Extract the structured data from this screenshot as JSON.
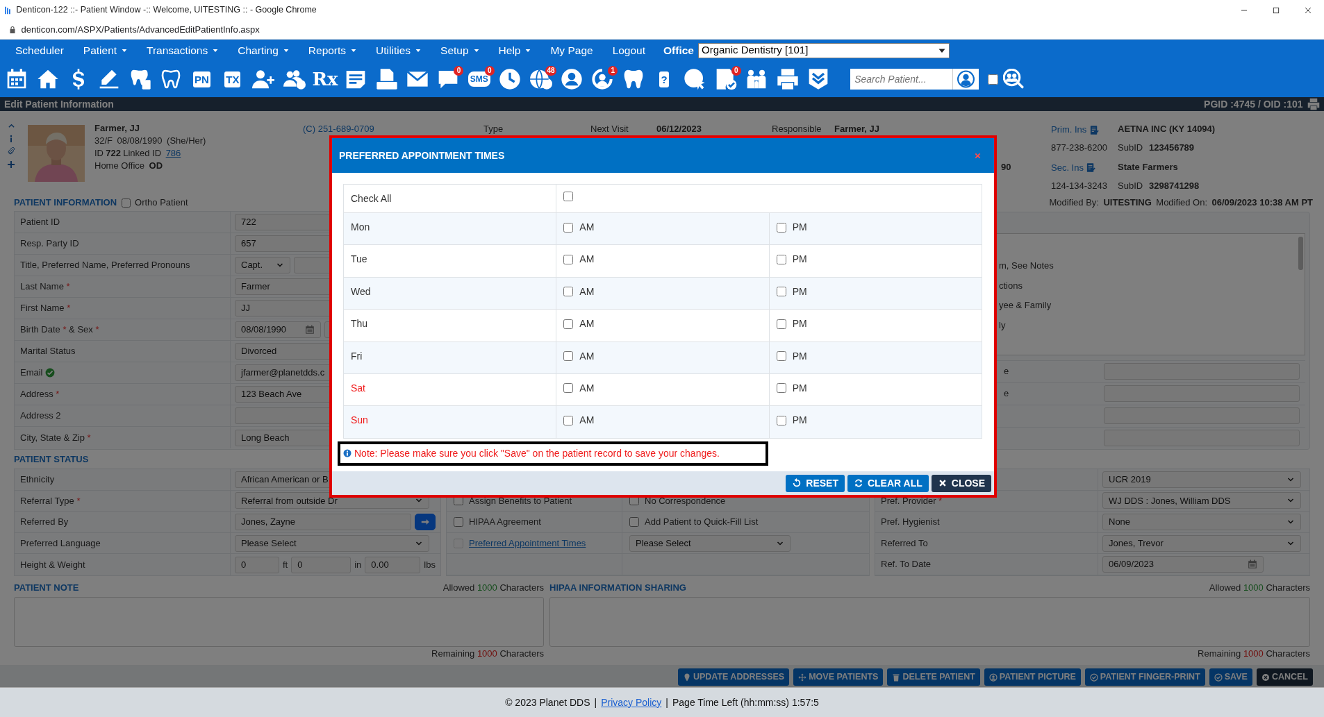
{
  "browser": {
    "title": "Denticon-122 ::- Patient Window -:: Welcome, UITESTING :: - Google Chrome",
    "url": "denticon.com/ASPX/Patients/AdvancedEditPatientInfo.aspx"
  },
  "menu": [
    {
      "label": "Scheduler",
      "dropdown": false
    },
    {
      "label": "Patient",
      "dropdown": true
    },
    {
      "label": "Transactions",
      "dropdown": true
    },
    {
      "label": "Charting",
      "dropdown": true
    },
    {
      "label": "Reports",
      "dropdown": true
    },
    {
      "label": "Utilities",
      "dropdown": true
    },
    {
      "label": "Setup",
      "dropdown": true
    },
    {
      "label": "Help",
      "dropdown": true
    },
    {
      "label": "My Page",
      "dropdown": false
    },
    {
      "label": "Logout",
      "dropdown": false
    }
  ],
  "office": {
    "label": "Office",
    "value": "Organic Dentistry [101]"
  },
  "toolbar": [
    {
      "kind": "calendar"
    },
    {
      "kind": "home"
    },
    {
      "kind": "dollar"
    },
    {
      "kind": "edit"
    },
    {
      "kind": "tooth-doc"
    },
    {
      "kind": "tooth-outline"
    },
    {
      "kind": "box-text",
      "label": "PN"
    },
    {
      "kind": "box-text",
      "label": "TX"
    },
    {
      "kind": "person-add"
    },
    {
      "kind": "people-add"
    },
    {
      "kind": "plain-text",
      "label": "Rx"
    },
    {
      "kind": "note"
    },
    {
      "kind": "scanner"
    },
    {
      "kind": "envelope"
    },
    {
      "kind": "chat",
      "badge": "0"
    },
    {
      "kind": "bubble-text",
      "label": "SMS",
      "badge": "0"
    },
    {
      "kind": "clock"
    },
    {
      "kind": "globe",
      "badge": "48"
    },
    {
      "kind": "support"
    },
    {
      "kind": "person-refresh",
      "badge": "1"
    },
    {
      "kind": "tooth"
    },
    {
      "kind": "box-text",
      "label": "?"
    },
    {
      "kind": "globe-cursor"
    },
    {
      "kind": "doc-check",
      "badge": "0"
    },
    {
      "kind": "family"
    },
    {
      "kind": "printer"
    },
    {
      "kind": "chevrons"
    }
  ],
  "patient_search": {
    "placeholder": "Search Patient...",
    "checked": false
  },
  "page_header": {
    "title": "Edit Patient Information",
    "ids": "PGID :4745 / OID :101"
  },
  "patient_card": {
    "name": "Farmer, JJ",
    "age_sex": "32/F",
    "birth_date": "08/08/1990",
    "pronouns": "(She/Her)",
    "id_label": "ID",
    "id": "722",
    "linked_label": "Linked ID",
    "linked_id": "786",
    "office_label": "Home Office",
    "office": "OD",
    "phone": "(C)  251-689-0709",
    "type_label": "Type",
    "next_visit_label": "Next Visit",
    "next_visit": "06/12/2023",
    "responsible_label": "Responsible",
    "responsible": "Farmer, JJ",
    "column_5": "90",
    "insurance": [
      {
        "label": "Prim. Ins",
        "name": "AETNA INC (KY 14094)",
        "phone": "877-238-6200",
        "subid_label": "SubID",
        "subid": "123456789"
      },
      {
        "label": "Sec. Ins",
        "name": "State Farmers",
        "phone": "124-134-3243",
        "subid_label": "SubID",
        "subid": "3298741298"
      }
    ]
  },
  "patient_information": {
    "title": "PATIENT INFORMATION",
    "ortho": {
      "label": "Ortho Patient",
      "checked": false
    },
    "modified_by_label": "Modified By:",
    "modified_by": "UITESTING",
    "modified_on_label": "Modified On:",
    "modified_on": "06/09/2023 10:38 AM PT",
    "rows": [
      {
        "label": "Patient ID",
        "kind": "input",
        "value": "722"
      },
      {
        "label": "Resp. Party ID",
        "kind": "input",
        "value": "657"
      },
      {
        "label": "Title, Preferred Name, Preferred Pronouns",
        "kind": "title",
        "value": "Capt."
      },
      {
        "label": "Last Name",
        "required_mark": "*",
        "kind": "input",
        "value": "Farmer"
      },
      {
        "label": "First Name",
        "required_mark": "*",
        "kind": "input",
        "value": "JJ"
      },
      {
        "label": "Birth Date",
        "required_mark": "*",
        "suffix": "& Sex",
        "suffix_mark": "*",
        "kind": "date",
        "value": "08/08/1990"
      },
      {
        "label": "Marital Status",
        "kind": "select",
        "value": "Divorced"
      },
      {
        "label": "Email",
        "verified": true,
        "kind": "input",
        "value": "jfarmer@planetdds.c"
      },
      {
        "label": "Address",
        "required_mark": "*",
        "kind": "input",
        "value": "123 Beach Ave"
      },
      {
        "label": "Address 2",
        "kind": "input"
      },
      {
        "label": "City, State & Zip",
        "required_mark": "*",
        "kind": "city",
        "value": "Long Beach"
      }
    ],
    "list_items": [
      "m, See Notes",
      "ctions",
      "yee & Family",
      "ly"
    ],
    "side_rows": [
      {
        "label": "e"
      },
      {
        "label": "e"
      },
      {},
      {}
    ]
  },
  "patient_status": {
    "title": "PATIENT STATUS",
    "rows": [
      {
        "label": "Ethnicity",
        "kind": "input",
        "value": "African American or B"
      },
      {
        "label": "Referral Type",
        "required_mark": "*",
        "kind": "select",
        "value": "Referral from outside Dr"
      },
      {
        "label": "Referred By",
        "kind": "lookup",
        "value": "Jones, Zayne"
      },
      {
        "label": "Preferred Language",
        "kind": "select",
        "value": "Please Select"
      },
      {
        "label": "Height & Weight",
        "kind": "measure",
        "feet": "0",
        "feet_unit": "ft",
        "inches": "0",
        "inches_unit": "in",
        "weight": "0.00",
        "weight_unit": "lbs"
      }
    ],
    "options": [
      {
        "kind": "checkbox",
        "label": "Assign Benefits to Patient",
        "checked": false,
        "disabled": false
      },
      {
        "kind": "checkbox",
        "label": "HIPAA Agreement",
        "checked": false,
        "disabled": false
      },
      {
        "kind": "link",
        "label": "Preferred Appointment Times",
        "checked": false,
        "disabled": true
      }
    ],
    "options_2": [
      {
        "kind": "checkbox",
        "label": "No Correspondence",
        "checked": false,
        "disabled": false
      },
      {
        "kind": "checkbox",
        "label": "Add Patient to Quick-Fill List",
        "checked": false,
        "disabled": false
      },
      {
        "kind": "select",
        "value": "Please Select"
      }
    ],
    "providers": [
      {
        "kind": "select",
        "value": "UCR 2019"
      },
      {
        "kind": "select",
        "label": "Pref. Provider",
        "required_mark": "*",
        "value": "WJ DDS : Jones, William DDS"
      },
      {
        "kind": "select",
        "label": "Pref. Hygienist",
        "value": "None"
      },
      {
        "kind": "select",
        "label": "Referred To",
        "value": "Jones, Trevor"
      },
      {
        "kind": "date",
        "label": "Ref. To Date",
        "value": "06/09/2023"
      }
    ]
  },
  "notes": [
    {
      "title": "PATIENT NOTE",
      "allowed_label": "Allowed",
      "allowed": "1000",
      "allowed_unit": "Characters",
      "remaining_label": "Remaining",
      "remaining": "1000",
      "remaining_unit": "Characters"
    },
    {
      "title": "HIPAA INFORMATION SHARING",
      "allowed_label": "Allowed",
      "allowed": "1000",
      "allowed_unit": "Characters",
      "remaining_label": "Remaining",
      "remaining": "1000",
      "remaining_unit": "Characters"
    }
  ],
  "actions": [
    {
      "label": "UPDATE ADDRESSES",
      "kind": "address"
    },
    {
      "label": "MOVE PATIENTS",
      "kind": "move"
    },
    {
      "label": "DELETE PATIENT",
      "kind": "delete"
    },
    {
      "label": "PATIENT PICTURE",
      "kind": "picture"
    },
    {
      "label": "PATIENT FINGER-PRINT",
      "kind": "fingerprint"
    },
    {
      "label": "SAVE",
      "kind": "save"
    },
    {
      "label": "CANCEL",
      "kind": "cancel"
    }
  ],
  "modal": {
    "title": "PREFERRED APPOINTMENT TIMES",
    "check_all": {
      "label": "Check All",
      "checked": false
    },
    "days": [
      {
        "label": "Mon",
        "weekend": false,
        "am": {
          "label": "AM",
          "checked": false
        },
        "pm": {
          "label": "PM",
          "checked": false
        }
      },
      {
        "label": "Tue",
        "weekend": false,
        "am": {
          "label": "AM",
          "checked": false
        },
        "pm": {
          "label": "PM",
          "checked": false
        }
      },
      {
        "label": "Wed",
        "weekend": false,
        "am": {
          "label": "AM",
          "checked": false
        },
        "pm": {
          "label": "PM",
          "checked": false
        }
      },
      {
        "label": "Thu",
        "weekend": false,
        "am": {
          "label": "AM",
          "checked": false
        },
        "pm": {
          "label": "PM",
          "checked": false
        }
      },
      {
        "label": "Fri",
        "weekend": false,
        "am": {
          "label": "AM",
          "checked": false
        },
        "pm": {
          "label": "PM",
          "checked": false
        }
      },
      {
        "label": "Sat",
        "weekend": true,
        "am": {
          "label": "AM",
          "checked": false
        },
        "pm": {
          "label": "PM",
          "checked": false
        }
      },
      {
        "label": "Sun",
        "weekend": true,
        "am": {
          "label": "AM",
          "checked": false
        },
        "pm": {
          "label": "PM",
          "checked": false
        }
      }
    ],
    "note": "Note: Please make sure you click \"Save\" on the patient record to save your changes.",
    "buttons": [
      {
        "label": "RESET",
        "kind": "reset"
      },
      {
        "label": "CLEAR ALL",
        "kind": "clear"
      },
      {
        "label": "CLOSE",
        "kind": "close"
      }
    ]
  },
  "footer": {
    "copyright": "© 2023 Planet DDS",
    "separator": "|",
    "link": "Privacy Policy",
    "separator_2": "|",
    "time_left": "Page Time Left (hh:mm:ss) 1:57:5"
  }
}
